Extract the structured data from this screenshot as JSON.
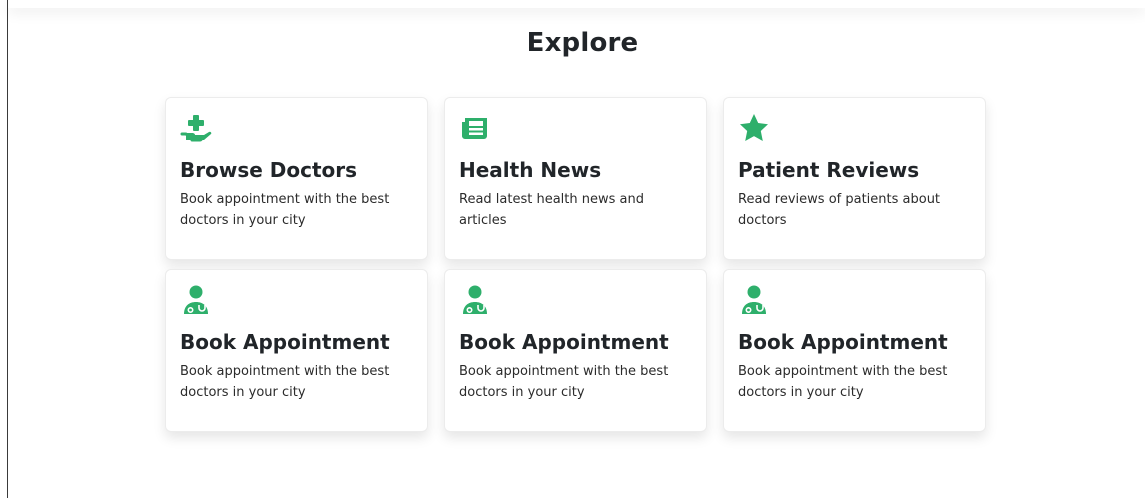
{
  "explore": {
    "title": "Explore",
    "accent_color": "#2eaf6b",
    "cards": [
      {
        "icon": "hand-holding-medical-icon",
        "title": "Browse Doctors",
        "text": "Book appointment with the best doctors in your city"
      },
      {
        "icon": "newspaper-icon",
        "title": "Health News",
        "text": "Read latest health news and articles"
      },
      {
        "icon": "star-icon",
        "title": "Patient Reviews",
        "text": "Read reviews of patients about doctors"
      },
      {
        "icon": "user-doctor-icon",
        "title": "Book Appointment",
        "text": "Book appointment with the best doctors in your city"
      },
      {
        "icon": "user-doctor-icon",
        "title": "Book Appointment",
        "text": "Book appointment with the best doctors in your city"
      },
      {
        "icon": "user-doctor-icon",
        "title": "Book Appointment",
        "text": "Book appointment with the best doctors in your city"
      }
    ]
  }
}
